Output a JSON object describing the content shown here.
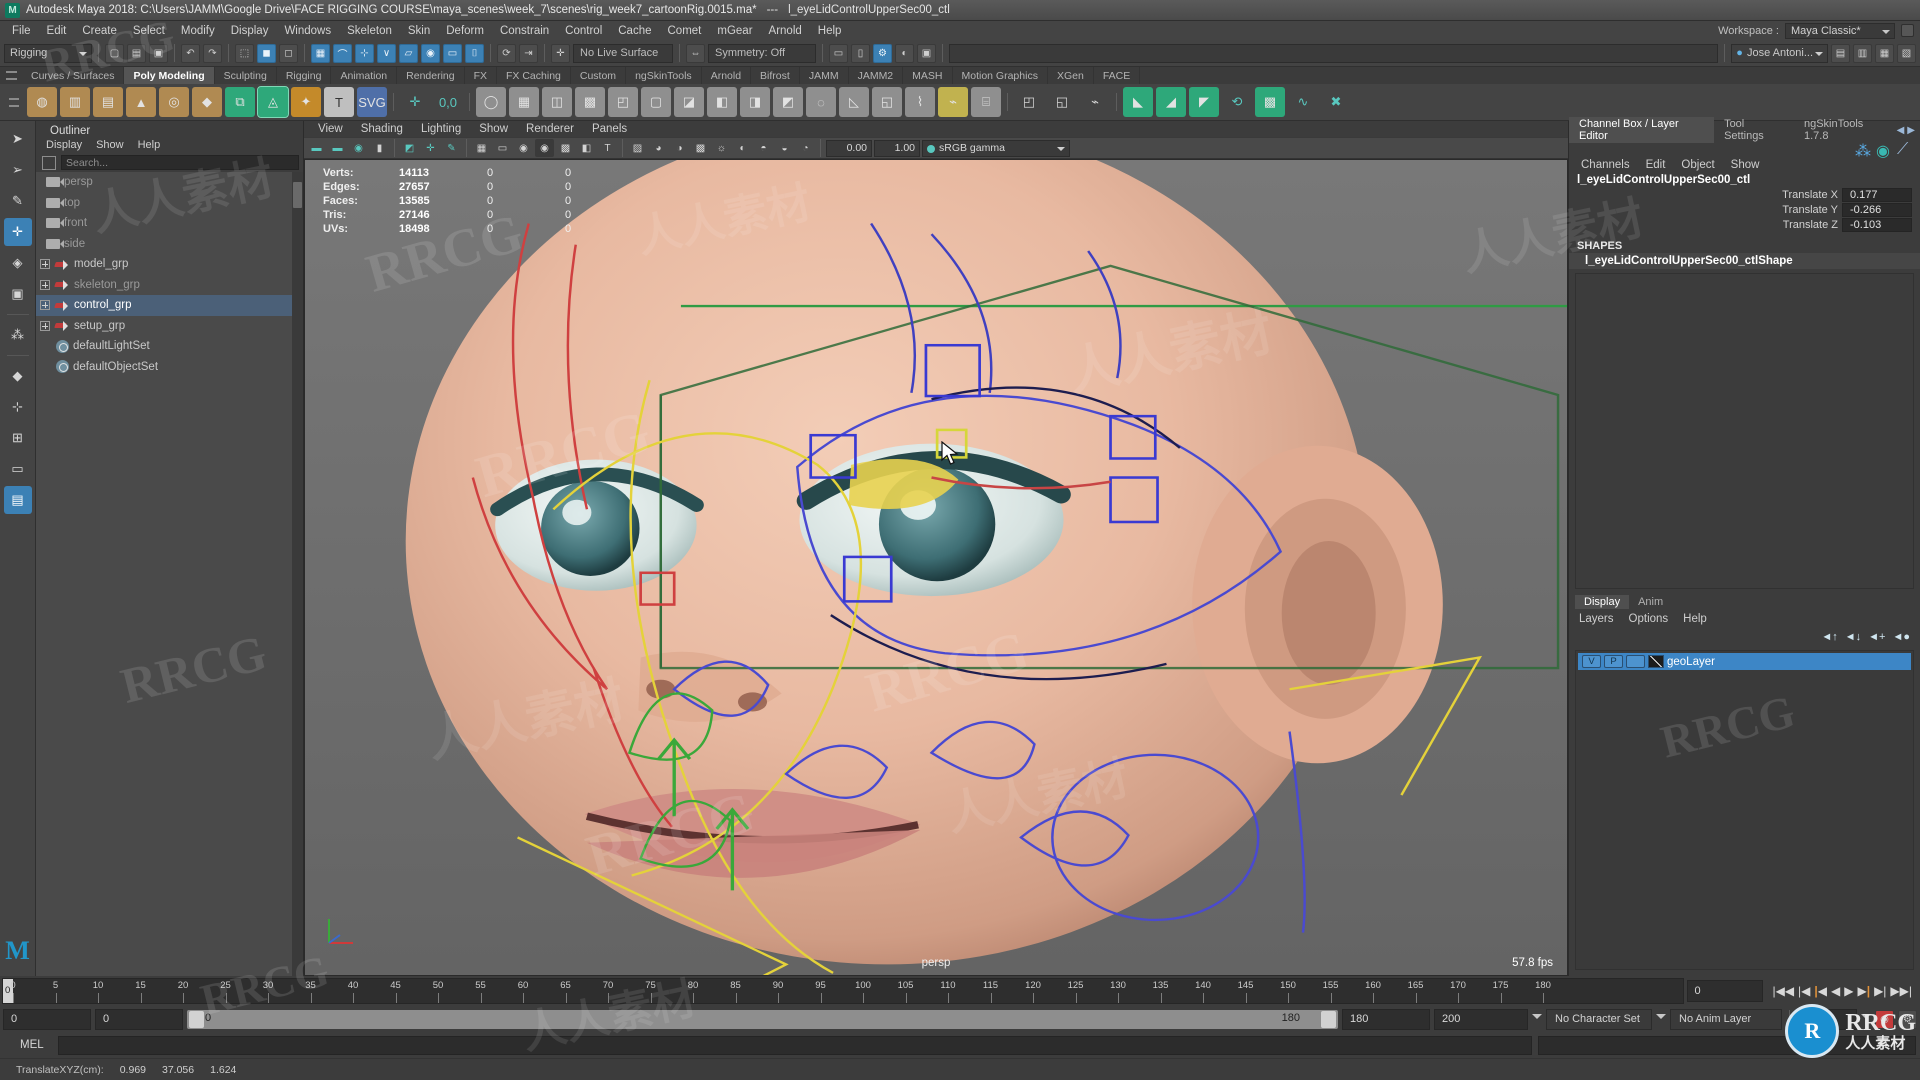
{
  "window": {
    "title": "Autodesk Maya 2018: C:\\Users\\JAMM\\Google Drive\\FACE RIGGING COURSE\\maya_scenes\\week_7\\scenes\\rig_week7_cartoonRig.0015.ma*",
    "title_separator": "---",
    "selected_object": "l_eyeLidControlUpperSec00_ctl",
    "app_icon": "maya-icon"
  },
  "menubar": {
    "items": [
      "File",
      "Edit",
      "Create",
      "Select",
      "Modify",
      "Display",
      "Windows",
      "Skeleton",
      "Skin",
      "Deform",
      "Constrain",
      "Control",
      "Cache",
      "Comet",
      "mGear",
      "Arnold",
      "Help"
    ],
    "workspace_label": "Workspace :",
    "workspace_value": "Maya Classic*"
  },
  "statusline": {
    "mode": "Rigging",
    "live_surface": "No Live Surface",
    "symmetry": "Symmetry: Off",
    "user": "Jose Antoni...",
    "icons": [
      "new-scene-icon",
      "open-scene-icon",
      "save-scene-icon",
      "undo-icon",
      "redo-icon",
      "select-by-hierarchy-icon",
      "select-by-object-icon",
      "select-by-component-icon",
      "snap-grid-icon",
      "snap-curve-icon",
      "snap-point-icon",
      "snap-view-plane-icon",
      "snap-live-icon",
      "render-icon",
      "ipr-render-icon",
      "render-settings-icon",
      "person-icon"
    ]
  },
  "shelf": {
    "tabs": [
      "Curves / Surfaces",
      "Poly Modeling",
      "Sculpting",
      "Rigging",
      "Animation",
      "Rendering",
      "FX",
      "FX Caching",
      "Custom",
      "ngSkinTools",
      "Arnold",
      "Bifrost",
      "JAMM",
      "JAMM2",
      "MASH",
      "Motion Graphics",
      "XGen",
      "FACE"
    ],
    "active_tab": "Poly Modeling",
    "icons": [
      "poly-sphere-icon",
      "poly-cube-icon",
      "poly-cylinder-icon",
      "poly-cone-icon",
      "poly-torus-icon",
      "poly-plane-icon",
      "combine-icon",
      "separate-icon",
      "booleans-icon",
      "smooth-icon",
      "text-icon",
      "svg-icon",
      "uv-editor-icon",
      "snap-together-icon",
      "sculpt-icon",
      "multi-cut-icon",
      "target-weld-icon",
      "quad-draw-icon",
      "bevel-icon",
      "bridge-icon",
      "extrude-icon",
      "merge-icon",
      "mirror-icon",
      "append-icon",
      "smooth-mesh-icon",
      "triangulate-icon",
      "quadrangulate-icon",
      "crease-icon",
      "transfer-attributes-icon",
      "clean-up-icon",
      "reduce-icon",
      "remesh-icon",
      "retopologize-icon",
      "sculpt-tools-icon"
    ]
  },
  "toolbox": {
    "items": [
      "select-tool-icon",
      "lasso-select-tool-icon",
      "paint-select-tool-icon",
      "move-tool-icon",
      "rotate-tool-icon",
      "scale-tool-icon",
      "universal-manipulator-icon",
      "soft-modification-icon",
      "show-manipulator-icon",
      "last-tool-icon",
      "single-view-layout-icon",
      "four-view-layout-icon",
      "persp-outliner-layout-icon",
      "hypergraph-layout-icon"
    ],
    "active": "move-tool-icon",
    "logo": "maya-logo"
  },
  "outliner": {
    "title": "Outliner",
    "menus": [
      "Display",
      "Show",
      "Help"
    ],
    "search_placeholder": "Search...",
    "search_value": "",
    "items": [
      {
        "label": "persp",
        "icon": "camera-icon",
        "indent": 1,
        "expandable": false,
        "selected": false,
        "dim": true
      },
      {
        "label": "top",
        "icon": "camera-icon",
        "indent": 1,
        "expandable": false,
        "selected": false,
        "dim": true
      },
      {
        "label": "front",
        "icon": "camera-icon",
        "indent": 1,
        "expandable": false,
        "selected": false,
        "dim": true
      },
      {
        "label": "side",
        "icon": "camera-icon",
        "indent": 1,
        "expandable": false,
        "selected": false,
        "dim": true
      },
      {
        "label": "model_grp",
        "icon": "group-icon",
        "indent": 0,
        "expandable": true,
        "selected": false,
        "dim": false
      },
      {
        "label": "skeleton_grp",
        "icon": "group-icon",
        "indent": 0,
        "expandable": true,
        "selected": false,
        "dim": true
      },
      {
        "label": "control_grp",
        "icon": "group-icon",
        "indent": 0,
        "expandable": true,
        "selected": true,
        "dim": false
      },
      {
        "label": "setup_grp",
        "icon": "group-icon",
        "indent": 0,
        "expandable": true,
        "selected": false,
        "dim": false
      },
      {
        "label": "defaultLightSet",
        "icon": "set-icon",
        "indent": 1,
        "expandable": false,
        "selected": false,
        "dim": false
      },
      {
        "label": "defaultObjectSet",
        "icon": "set-icon",
        "indent": 1,
        "expandable": false,
        "selected": false,
        "dim": false
      }
    ]
  },
  "viewport": {
    "menus": [
      "View",
      "Shading",
      "Lighting",
      "Show",
      "Renderer",
      "Panels"
    ],
    "exposure": "0.00",
    "gamma": "1.00",
    "color_mgmt": "sRGB gamma",
    "camera_label": "persp",
    "fps": "57.8 fps",
    "hud": {
      "columns": [
        "name",
        "total",
        "col2",
        "col3"
      ],
      "rows": [
        {
          "name": "Verts:",
          "total": "14113",
          "col2": "0",
          "col3": "0"
        },
        {
          "name": "Edges:",
          "total": "27657",
          "col2": "0",
          "col3": "0"
        },
        {
          "name": "Faces:",
          "total": "13585",
          "col2": "0",
          "col3": "0"
        },
        {
          "name": "Tris:",
          "total": "27146",
          "col2": "0",
          "col3": "0"
        },
        {
          "name": "UVs:",
          "total": "18498",
          "col2": "0",
          "col3": "0"
        }
      ]
    }
  },
  "channelbox": {
    "tabs": [
      "Channel Box / Layer Editor",
      "Tool Settings",
      "ngSkinTools 1.7.8"
    ],
    "active_tab": "Channel Box / Layer Editor",
    "menus": [
      "Channels",
      "Edit",
      "Object",
      "Show"
    ],
    "object_name": "l_eyeLidControlUpperSec00_ctl",
    "attributes": [
      {
        "name": "Translate X",
        "value": "0.177"
      },
      {
        "name": "Translate Y",
        "value": "-0.266"
      },
      {
        "name": "Translate Z",
        "value": "-0.103"
      }
    ],
    "shapes_header": "SHAPES",
    "shape_name": "l_eyeLidControlUpperSec00_ctlShape"
  },
  "layereditor": {
    "tabs": [
      "Display",
      "Anim"
    ],
    "active_tab": "Display",
    "menus": [
      "Layers",
      "Options",
      "Help"
    ],
    "tool_icons": [
      "move-layer-up-icon",
      "move-layer-down-icon",
      "new-layer-icon",
      "new-layer-from-selected-icon"
    ],
    "layers": [
      {
        "visibility": "V",
        "playback": "P",
        "shading": "",
        "name": "geoLayer",
        "selected": true
      }
    ]
  },
  "timeslider": {
    "start": 0,
    "end": 120,
    "tick_labels": [
      "0",
      "5",
      "10",
      "15",
      "20",
      "25",
      "30",
      "35",
      "40",
      "45",
      "50",
      "55",
      "60",
      "65",
      "70",
      "75",
      "80",
      "85",
      "90",
      "95",
      "100",
      "105",
      "110",
      "115",
      "120",
      "125",
      "130",
      "135",
      "140",
      "145",
      "150",
      "155",
      "160",
      "165",
      "170",
      "175",
      "180"
    ],
    "current_frame": "0",
    "current_frame_field": "0",
    "playback_buttons": [
      "go-to-start-icon",
      "step-back-key-icon",
      "step-back-frame-icon",
      "play-backwards-icon",
      "play-forwards-icon",
      "step-forward-frame-icon",
      "step-forward-key-icon",
      "go-to-end-icon"
    ]
  },
  "rangeslider": {
    "anim_start": "0",
    "range_start": "0",
    "range_bar_label": "0",
    "range_end_label": "180",
    "anim_end": "180",
    "playback_end": "200",
    "character_set": "No Character Set",
    "anim_layer": "No Anim Layer",
    "fps_field": "24"
  },
  "commandline": {
    "label": "MEL",
    "input_value": "",
    "output_value": ""
  },
  "helpline": {
    "label": "TranslateXYZ(cm):",
    "values": [
      "0.969",
      "37.056",
      "1.624"
    ]
  },
  "watermarks": {
    "brand": "RRCG",
    "cn_text": "人人素材",
    "logo_letter": "R",
    "logo_line1": "RRCG",
    "logo_line2": "人人素材"
  },
  "colors": {
    "accent_blue": "#3d86c6",
    "selection_blue": "#4b6078",
    "shelf_active": "#555555",
    "panel_bg": "#3c3c3c",
    "viewport_bg": "#6f6f6f",
    "highlight_teal": "#59c8bf"
  }
}
